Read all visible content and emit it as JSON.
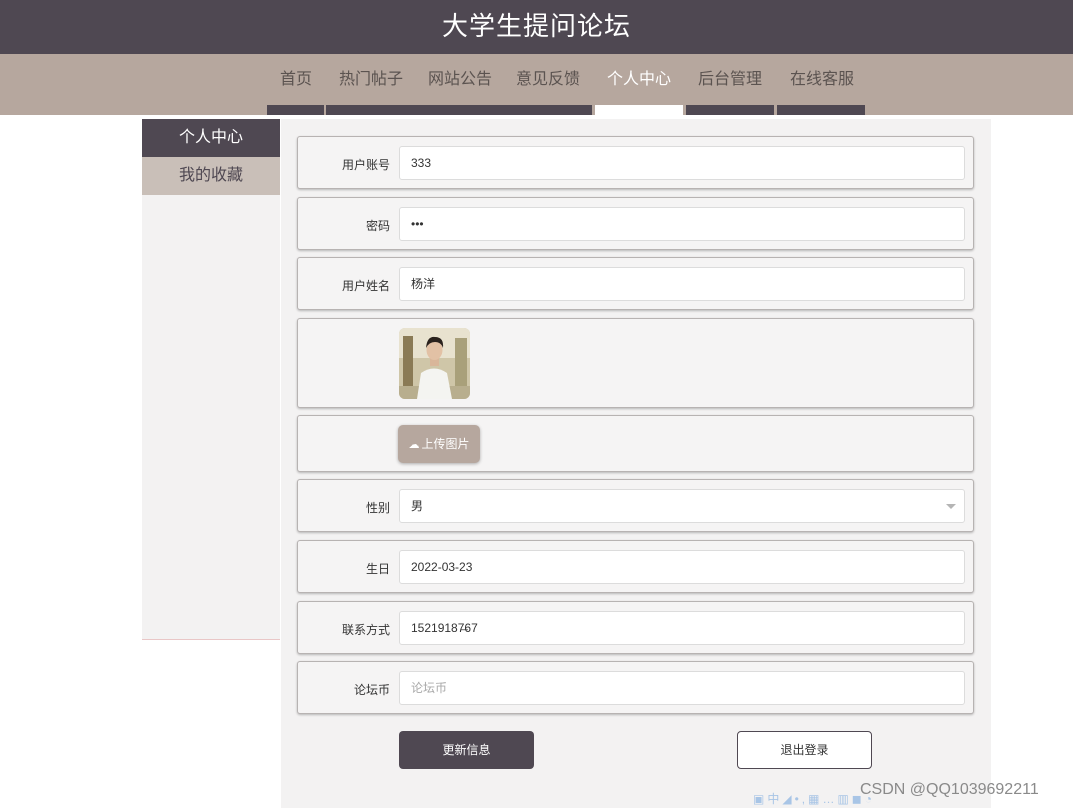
{
  "app": {
    "title": "大学生提问论坛"
  },
  "nav": {
    "items": [
      {
        "label": "首页"
      },
      {
        "label": "热门帖子"
      },
      {
        "label": "网站公告"
      },
      {
        "label": "意见反馈"
      },
      {
        "label": "个人中心",
        "active": true
      },
      {
        "label": "后台管理"
      },
      {
        "label": "在线客服"
      }
    ]
  },
  "sidebar": {
    "items": [
      {
        "label": "个人中心",
        "active": true
      },
      {
        "label": "我的收藏"
      }
    ]
  },
  "form": {
    "account": {
      "label": "用户账号",
      "value": "333"
    },
    "password": {
      "label": "密码",
      "value": "•••"
    },
    "name": {
      "label": "用户姓名",
      "value": "杨洋"
    },
    "avatar": {
      "icon": "user-photo"
    },
    "upload": {
      "label": "上传图片",
      "icon": "cloud-upload-icon"
    },
    "gender": {
      "label": "性别",
      "value": "男"
    },
    "birthday": {
      "label": "生日",
      "value": "2022-03-23"
    },
    "contact": {
      "label": "联系方式",
      "value": "15219187̶67"
    },
    "coins": {
      "label": "论坛币",
      "placeholder": "论坛币"
    },
    "update_label": "更新信息",
    "logout_label": "退出登录"
  },
  "watermark": "CSDN @QQ1039692211",
  "colors": {
    "header": "#4f4852",
    "nav": "#b6a79e",
    "accent": "#c9bfb8"
  }
}
